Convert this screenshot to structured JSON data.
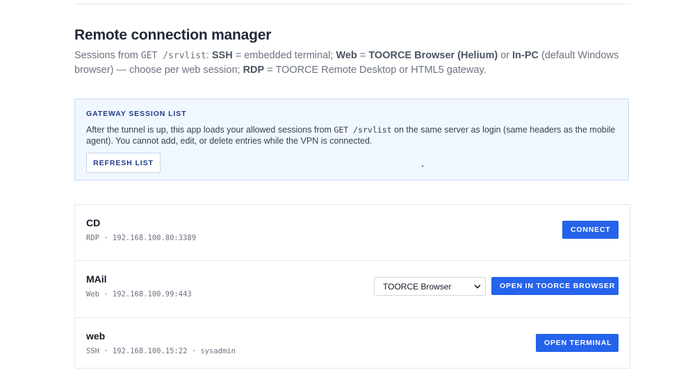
{
  "page": {
    "title": "Remote connection manager",
    "intro": {
      "p1": "Sessions from ",
      "endpoint": "GET /srvlist",
      "p2": ": ",
      "ssh_label": "SSH",
      "p3": " = embedded terminal; ",
      "web_label": "Web",
      "p4": " = ",
      "toorce_browser_label": "TOORCE Browser (Helium)",
      "p5": " or ",
      "inpc_label": "In-PC",
      "p6": " (default Windows browser) — choose per web session; ",
      "rdp_label": "RDP",
      "p7": " = TOORCE Remote Desktop or HTML5 gateway."
    }
  },
  "gateway": {
    "heading": "GATEWAY SESSION LIST",
    "text1": "After the tunnel is up, this app loads your allowed sessions from ",
    "endpoint": "GET /srvlist",
    "text2": " on the same server as login (same headers as the mobile agent). You cannot add, edit, or delete entries while the VPN is connected.",
    "refresh_label": "REFRESH LIST"
  },
  "sessions": [
    {
      "name": "CD",
      "meta": "RDP · 192.168.100.80:3389",
      "action_label": "CONNECT"
    },
    {
      "name": "MAil",
      "meta": "Web · 192.168.100.99:443",
      "browser_selected": "TOORCE Browser",
      "action_label": "OPEN IN TOORCE BROWSER"
    },
    {
      "name": "web",
      "meta": "SSH · 192.168.100.15:22 · sysadmin",
      "action_label": "OPEN TERMINAL"
    }
  ],
  "colors": {
    "accent": "#2563eb",
    "info_bg": "#f1f7fe",
    "info_border": "#c5daf1",
    "heading_navy": "#1e3a8a"
  },
  "icons": {
    "select_chevron": "chevron-down-icon"
  }
}
